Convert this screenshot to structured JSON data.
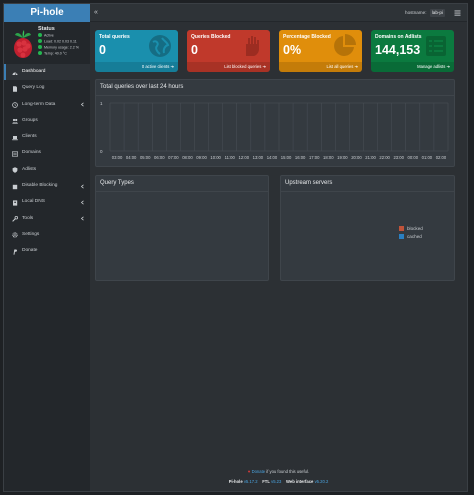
{
  "app": {
    "logo": "Pi-hole"
  },
  "status": {
    "title": "Status",
    "lines": [
      "Active",
      "Load: 0.02 0.03 0.11",
      "Memory usage: 2.2 %",
      "Temp: 40.0 °C"
    ],
    "dot_color": "#24b650"
  },
  "sidebar": {
    "items": [
      {
        "label": "Dashboard",
        "icon": "dashboard-icon"
      },
      {
        "label": "Query Log",
        "icon": "file-icon"
      },
      {
        "label": "Long-term Data",
        "icon": "history-icon"
      },
      {
        "label": "Groups",
        "icon": "users-icon"
      },
      {
        "label": "Clients",
        "icon": "laptop-icon"
      },
      {
        "label": "Domains",
        "icon": "list-icon"
      },
      {
        "label": "Adlists",
        "icon": "shield-icon"
      },
      {
        "label": "Disable Blocking",
        "icon": "stop-icon"
      },
      {
        "label": "Local DNS",
        "icon": "address-book-icon"
      },
      {
        "label": "Tools",
        "icon": "tools-icon"
      },
      {
        "label": "Settings",
        "icon": "gear-icon"
      },
      {
        "label": "Donate",
        "icon": "paypal-icon"
      }
    ]
  },
  "topbar": {
    "hostname_label": "hostname:",
    "hostname": "lab-pi"
  },
  "boxes": [
    {
      "title": "Total queries",
      "value": "0",
      "footer": "0 active clients",
      "color": "#1a8fad"
    },
    {
      "title": "Queries Blocked",
      "value": "0",
      "footer": "List blocked queries",
      "color": "#c0392b"
    },
    {
      "title": "Percentage Blocked",
      "value": "0%",
      "footer": "List all queries",
      "color": "#e08e0b"
    },
    {
      "title": "Domains on Adlists",
      "value": "144,153",
      "footer": "Manage adlists",
      "color": "#0b7a3f"
    }
  ],
  "panels": {
    "queries_title": "Total queries over last 24 hours",
    "query_types_title": "Query Types",
    "upstream_title": "Upstream servers"
  },
  "legend": [
    {
      "label": "blocked",
      "color": "#c0533a"
    },
    {
      "label": "cached",
      "color": "#2a7fc1"
    }
  ],
  "chart_data": {
    "type": "bar",
    "title": "Total queries over last 24 hours",
    "categories": [
      "03:00",
      "04:00",
      "05:00",
      "06:00",
      "07:00",
      "08:00",
      "09:00",
      "10:00",
      "11:00",
      "12:00",
      "13:00",
      "14:00",
      "15:00",
      "16:00",
      "17:00",
      "18:00",
      "19:00",
      "20:00",
      "21:00",
      "22:00",
      "23:00",
      "00:00",
      "01:00",
      "02:00"
    ],
    "y_ticks": [
      "1",
      "0"
    ],
    "ylim": [
      0,
      1
    ],
    "values": [
      0,
      0,
      0,
      0,
      0,
      0,
      0,
      0,
      0,
      0,
      0,
      0,
      0,
      0,
      0,
      0,
      0,
      0,
      0,
      0,
      0,
      0,
      0,
      0
    ],
    "grid": true
  },
  "footer": {
    "donate_link": "Donate",
    "donate_text": " if you found this useful.",
    "pihole_label": "Pi-hole",
    "pihole_version": "v5.17.2",
    "ftl_label": "FTL",
    "ftl_version": "v5.23",
    "web_label": "Web interface",
    "web_version": "v5.20.2"
  }
}
